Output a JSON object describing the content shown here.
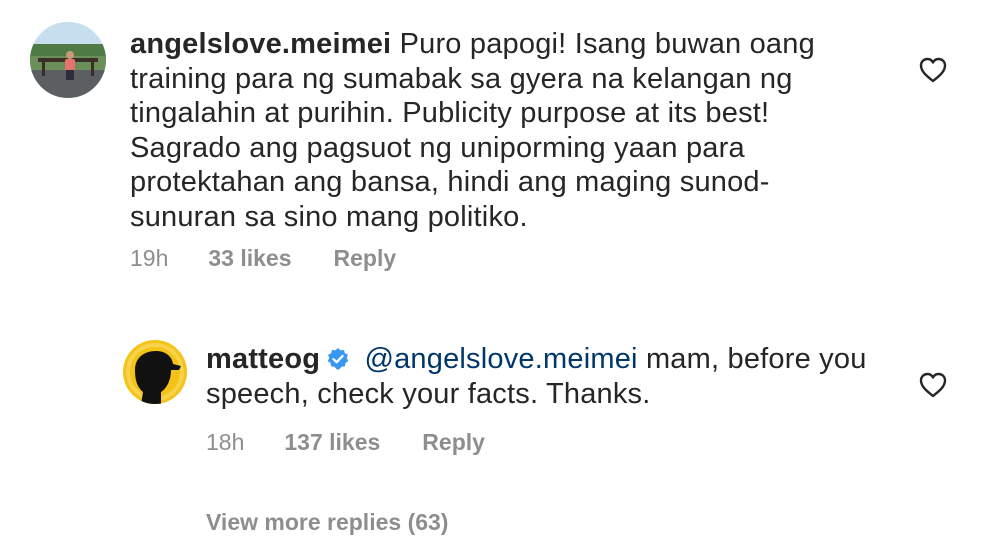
{
  "comments": [
    {
      "username": "angelslove.meimei",
      "verified": false,
      "text": "Puro papogi! Isang buwan oang training para ng sumabak sa gyera na kelangan ng tingalahin at purihin. Publicity purpose at its best! Sagrado ang pagsuot ng uniporming yaan para protektahan ang bansa, hindi ang maging sunod-sunuran sa sino mang politiko.",
      "time": "19h",
      "likes": "33 likes",
      "reply_label": "Reply",
      "avatar_icon": "profile-photo-person-outdoors",
      "like_icon": "heart-outline-icon"
    },
    {
      "username": "matteog",
      "verified": true,
      "mention": "@angelslove.meimei",
      "text": "mam, before you speech, check your facts. Thanks.",
      "time": "18h",
      "likes": "137 likes",
      "reply_label": "Reply",
      "avatar_icon": "profile-photo-silhouette-cap",
      "like_icon": "heart-outline-icon"
    }
  ],
  "view_more_replies": "View more replies (63)",
  "colors": {
    "text": "#262626",
    "secondary": "#8e8e8e",
    "mention": "#00376b",
    "verified": "#3897f0",
    "background": "#ffffff"
  }
}
